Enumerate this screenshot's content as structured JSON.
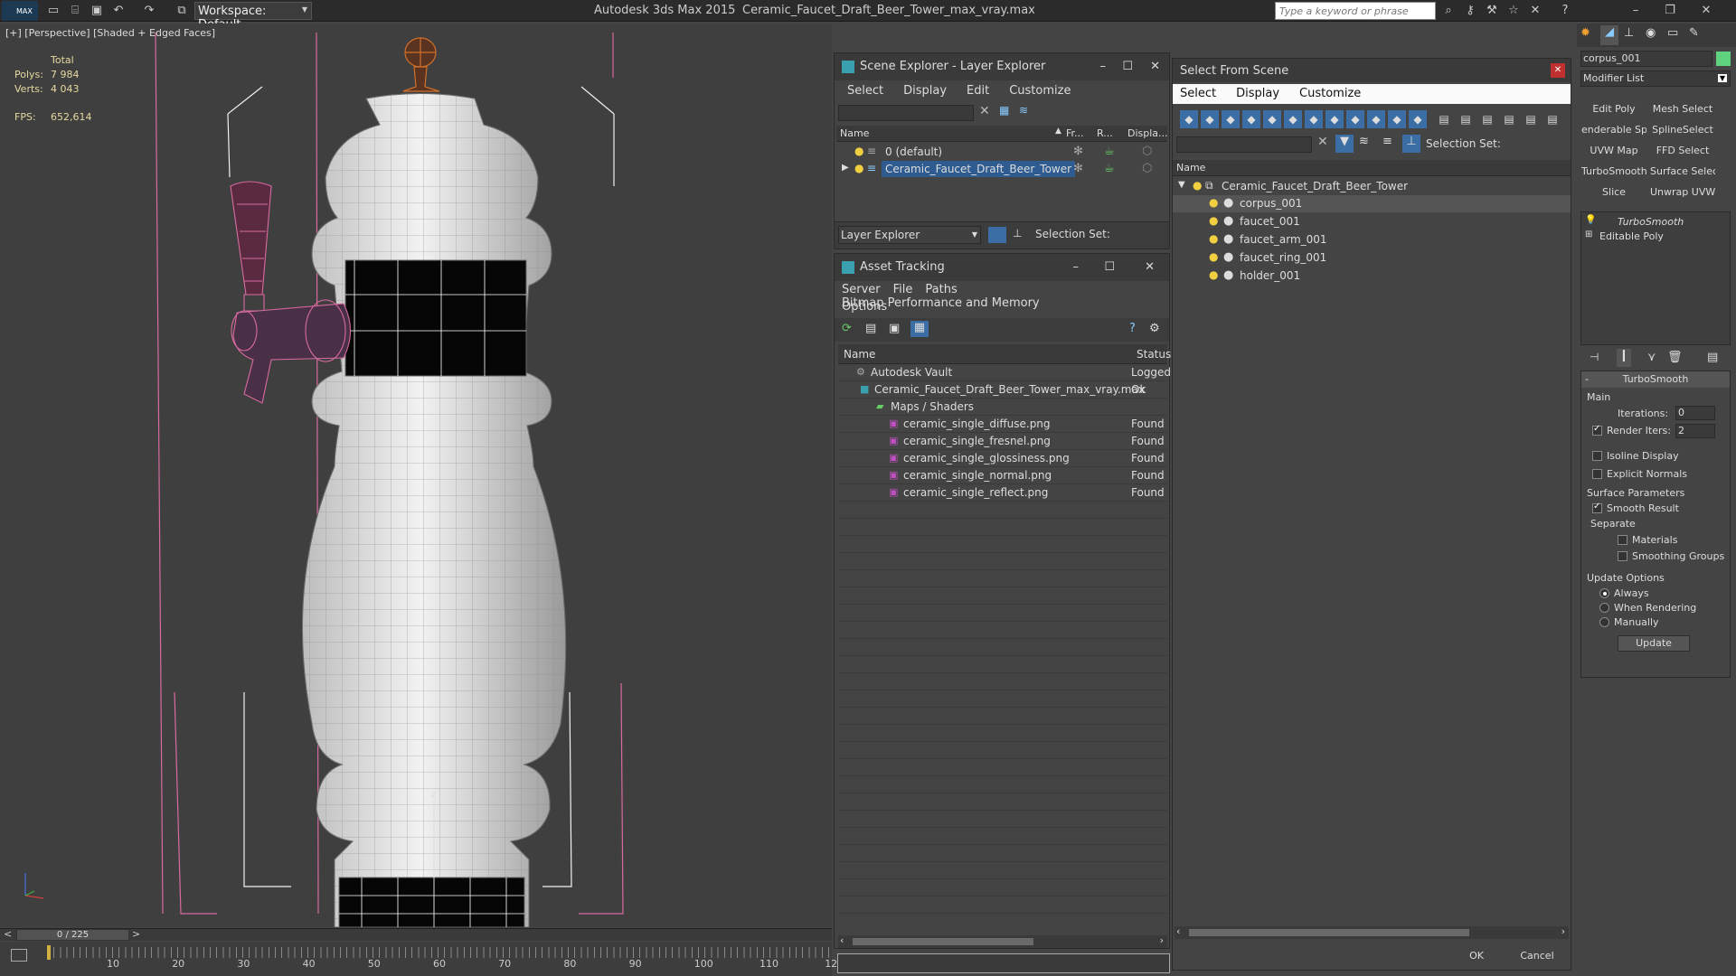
{
  "app": {
    "title": "Autodesk 3ds Max  2015",
    "file": "Ceramic_Faucet_Draft_Beer_Tower_max_vray.max",
    "workspace": "Workspace: Default",
    "search_placeholder": "Type a keyword or phrase",
    "logo": "MAX"
  },
  "viewport": {
    "label": "[+] [Perspective] [Shaded + Edged Faces]",
    "stats": {
      "total_label": "Total",
      "polys_label": "Polys:",
      "polys": "7 984",
      "verts_label": "Verts:",
      "verts": "4 043",
      "fps_label": "FPS:",
      "fps": "652,614"
    },
    "axis_z": "z"
  },
  "timeline": {
    "frame": "0 / 225",
    "ticks": [
      "10",
      "20",
      "30",
      "40",
      "50",
      "60",
      "70",
      "80",
      "90",
      "100",
      "110",
      "12"
    ]
  },
  "scene_explorer": {
    "title": "Scene Explorer - Layer Explorer",
    "menu": [
      "Select",
      "Display",
      "Edit",
      "Customize"
    ],
    "columns": [
      "Name",
      "Fr...",
      "R...",
      "Displa..."
    ],
    "rows": [
      "0 (default)",
      "Ceramic_Faucet_Draft_Beer_Tower"
    ],
    "footer_mode": "Layer Explorer",
    "footer_selset": "Selection Set:"
  },
  "asset_tracking": {
    "title": "Asset Tracking",
    "menu": [
      "Server",
      "File",
      "Paths",
      "Bitmap Performance and Memory"
    ],
    "menu2": "Options",
    "columns": [
      "Name",
      "Status"
    ],
    "rows": [
      {
        "name": "Autodesk Vault",
        "status": "Logged"
      },
      {
        "name": "Ceramic_Faucet_Draft_Beer_Tower_max_vray.max",
        "status": "Ok"
      },
      {
        "name": "Maps / Shaders",
        "status": ""
      },
      {
        "name": "ceramic_single_diffuse.png",
        "status": "Found"
      },
      {
        "name": "ceramic_single_fresnel.png",
        "status": "Found"
      },
      {
        "name": "ceramic_single_glossiness.png",
        "status": "Found"
      },
      {
        "name": "ceramic_single_normal.png",
        "status": "Found"
      },
      {
        "name": "ceramic_single_reflect.png",
        "status": "Found"
      }
    ]
  },
  "select_from_scene": {
    "title": "Select From Scene",
    "menu": [
      "Select",
      "Display",
      "Customize"
    ],
    "selset": "Selection Set:",
    "column": "Name",
    "root": "Ceramic_Faucet_Draft_Beer_Tower",
    "children": [
      "corpus_001",
      "faucet_001",
      "faucet_arm_001",
      "faucet_ring_001",
      "holder_001"
    ],
    "ok": "OK",
    "cancel": "Cancel"
  },
  "command_panel": {
    "object_name": "corpus_001",
    "modifier_list": "Modifier List",
    "buttons": [
      "Edit Poly",
      "Mesh Select",
      "enderable Splir",
      "SplineSelect",
      "UVW Map",
      "FFD Select",
      "TurboSmooth",
      "Surface Select",
      "Slice",
      "Unwrap UVW"
    ],
    "stack": [
      "TurboSmooth",
      "Editable Poly"
    ],
    "rollout": "TurboSmooth",
    "main": "Main",
    "iterations_label": "Iterations:",
    "iterations": "0",
    "render_iters_label": "Render Iters:",
    "render_iters": "2",
    "isoline": "Isoline Display",
    "explicit": "Explicit Normals",
    "surface_params": "Surface Parameters",
    "smooth_result": "Smooth Result",
    "separate": "Separate",
    "materials": "Materials",
    "smoothing_groups": "Smoothing Groups",
    "update_options": "Update Options",
    "always": "Always",
    "when_rendering": "When Rendering",
    "manually": "Manually",
    "update": "Update"
  }
}
